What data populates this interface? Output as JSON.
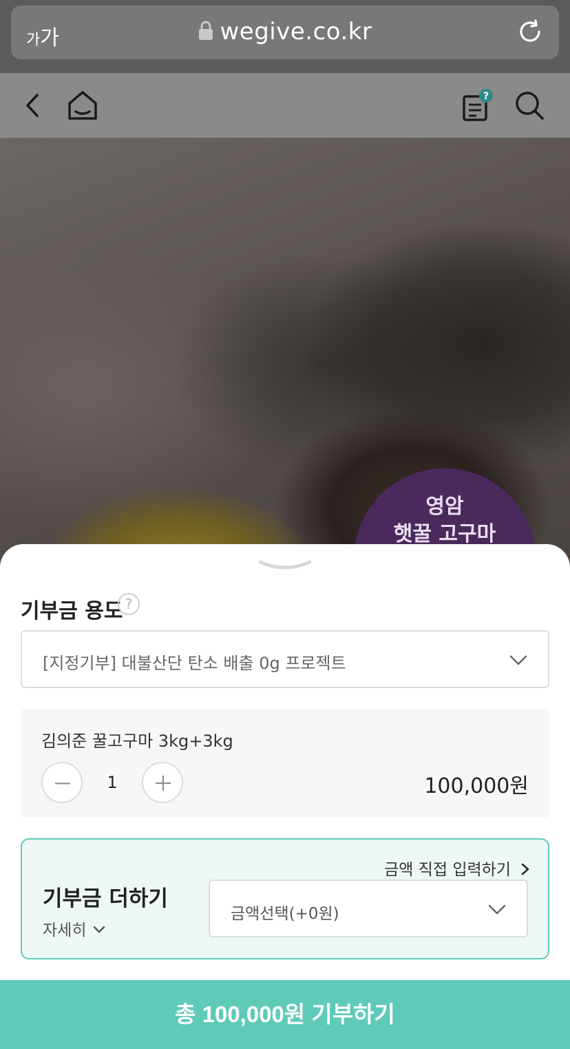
{
  "browser": {
    "reader_small": "가",
    "reader_large": "가",
    "url": "wegive.co.kr"
  },
  "hero": {
    "badge_line1": "영암",
    "badge_line2": "햇꿀 고구마"
  },
  "sheet": {
    "usage_title": "기부금 용도",
    "help_glyph": "?",
    "usage_selected": "[지정기부] 대불산단 탄소 배출 0g 프로젝트",
    "product_name": "김의준 꿀고구마 3kg+3kg",
    "quantity": "1",
    "price": "100,000원",
    "direct_input_label": "금액 직접 입력하기",
    "add_title": "기부금 더하기",
    "detail_label": "자세히",
    "amount_selected": "금액선택(+0원)",
    "cta_label": "총 100,000원 기부하기"
  },
  "colors": {
    "accent": "#5fcab7",
    "badge": "#4a2a5c"
  }
}
